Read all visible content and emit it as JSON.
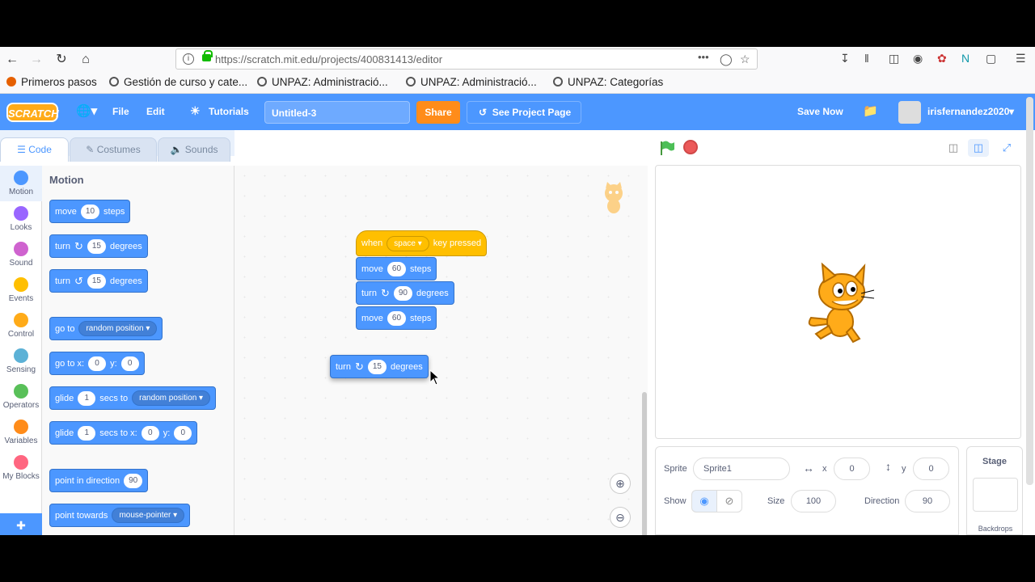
{
  "browser": {
    "url": "https://scratch.mit.edu/projects/400831413/editor",
    "url_host": "https://scratch.mit.edu/projects/400831413/editor",
    "menu_dots": "•••",
    "bookmarks": [
      {
        "label": "Primeros pasos",
        "color": "#e66000"
      },
      {
        "label": "Gestión de curso y cate...",
        "color": "#555"
      },
      {
        "label": "UNPAZ: Administració...",
        "color": "#555"
      },
      {
        "label": "UNPAZ: Administració...",
        "color": "#555"
      },
      {
        "label": "UNPAZ: Categorías",
        "color": "#555"
      }
    ]
  },
  "menubar": {
    "logo": "SCRATCH",
    "file": "File",
    "edit": "Edit",
    "tutorials": "Tutorials",
    "project_title": "Untitled-3",
    "share": "Share",
    "see_project": "See Project Page",
    "save_now": "Save Now",
    "username": "irisfernandez2020"
  },
  "tabs": {
    "code": "Code",
    "costumes": "Costumes",
    "sounds": "Sounds"
  },
  "categories": [
    {
      "label": "Motion",
      "color": "#4c97ff"
    },
    {
      "label": "Looks",
      "color": "#9966ff"
    },
    {
      "label": "Sound",
      "color": "#cf63cf"
    },
    {
      "label": "Events",
      "color": "#ffbf00"
    },
    {
      "label": "Control",
      "color": "#ffab19"
    },
    {
      "label": "Sensing",
      "color": "#5cb1d6"
    },
    {
      "label": "Operators",
      "color": "#59c059"
    },
    {
      "label": "Variables",
      "color": "#ff8c1a"
    },
    {
      "label": "My Blocks",
      "color": "#ff6680"
    }
  ],
  "palette": {
    "heading": "Motion",
    "move": {
      "t1": "move",
      "v": "10",
      "t2": "steps"
    },
    "turn_right": {
      "t1": "turn",
      "v": "15",
      "t2": "degrees"
    },
    "turn_left": {
      "t1": "turn",
      "v": "15",
      "t2": "degrees"
    },
    "goto": {
      "t1": "go to",
      "dd": "random position"
    },
    "gotoxy": {
      "t1": "go to x:",
      "x": "0",
      "t2": "y:",
      "y": "0"
    },
    "glide1": {
      "t1": "glide",
      "v": "1",
      "t2": "secs to",
      "dd": "random position"
    },
    "glide2": {
      "t1": "glide",
      "v": "1",
      "t2": "secs to x:",
      "x": "0",
      "t3": "y:",
      "y": "0"
    },
    "point_dir": {
      "t1": "point in direction",
      "v": "90"
    },
    "point_towards": {
      "t1": "point towards",
      "dd": "mouse-pointer"
    }
  },
  "script": {
    "hat": {
      "t1": "when",
      "dd": "space",
      "t2": "key pressed"
    },
    "move1": {
      "t1": "move",
      "v": "60",
      "t2": "steps"
    },
    "turn": {
      "t1": "turn",
      "v": "90",
      "t2": "degrees"
    },
    "move2": {
      "t1": "move",
      "v": "60",
      "t2": "steps"
    },
    "dragging": {
      "t1": "turn",
      "v": "15",
      "t2": "degrees"
    }
  },
  "sprite_info": {
    "sprite_label": "Sprite",
    "sprite_name": "Sprite1",
    "x_label": "x",
    "x": "0",
    "y_label": "y",
    "y": "0",
    "show_label": "Show",
    "size_label": "Size",
    "size": "100",
    "direction_label": "Direction",
    "direction": "90"
  },
  "stage_panel": {
    "title": "Stage",
    "backdrops": "Backdrops"
  }
}
